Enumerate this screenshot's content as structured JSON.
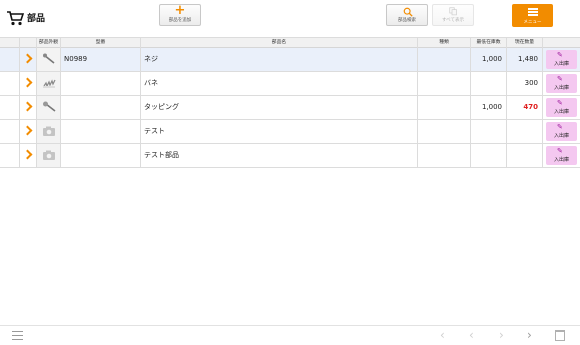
{
  "header": {
    "title": "部品",
    "add_button": "部品を追加",
    "search_button": "部品検索",
    "show_all_button": "すべて表示",
    "menu_button": "メニュー"
  },
  "table": {
    "headers": {
      "image": "部品外観",
      "model": "型番",
      "name": "部品名",
      "kind": "種類",
      "min_stock": "最低在庫数",
      "stock": "現在数量"
    },
    "io_label": "入出庫",
    "rows": [
      {
        "model": "N0989",
        "name": "ネジ",
        "kind": "",
        "min_stock": "1,000",
        "stock": "1,480",
        "thumb": "screw-icon",
        "stock_low": false
      },
      {
        "model": "",
        "name": "バネ",
        "kind": "",
        "min_stock": "",
        "stock": "300",
        "thumb": "spring-icon",
        "stock_low": false
      },
      {
        "model": "",
        "name": "タッピング",
        "kind": "",
        "min_stock": "1,000",
        "stock": "470",
        "thumb": "tapping-screw-icon",
        "stock_low": true
      },
      {
        "model": "",
        "name": "テスト",
        "kind": "",
        "min_stock": "",
        "stock": "",
        "thumb": "camera-icon",
        "stock_low": false
      },
      {
        "model": "",
        "name": "テスト部品",
        "kind": "",
        "min_stock": "",
        "stock": "",
        "thumb": "camera-icon",
        "stock_low": false
      }
    ]
  },
  "colors": {
    "accent": "#f28c00",
    "low_stock": "#e02020",
    "io_button": "#f4c8f0",
    "selected_row": "#eaf0fa"
  }
}
